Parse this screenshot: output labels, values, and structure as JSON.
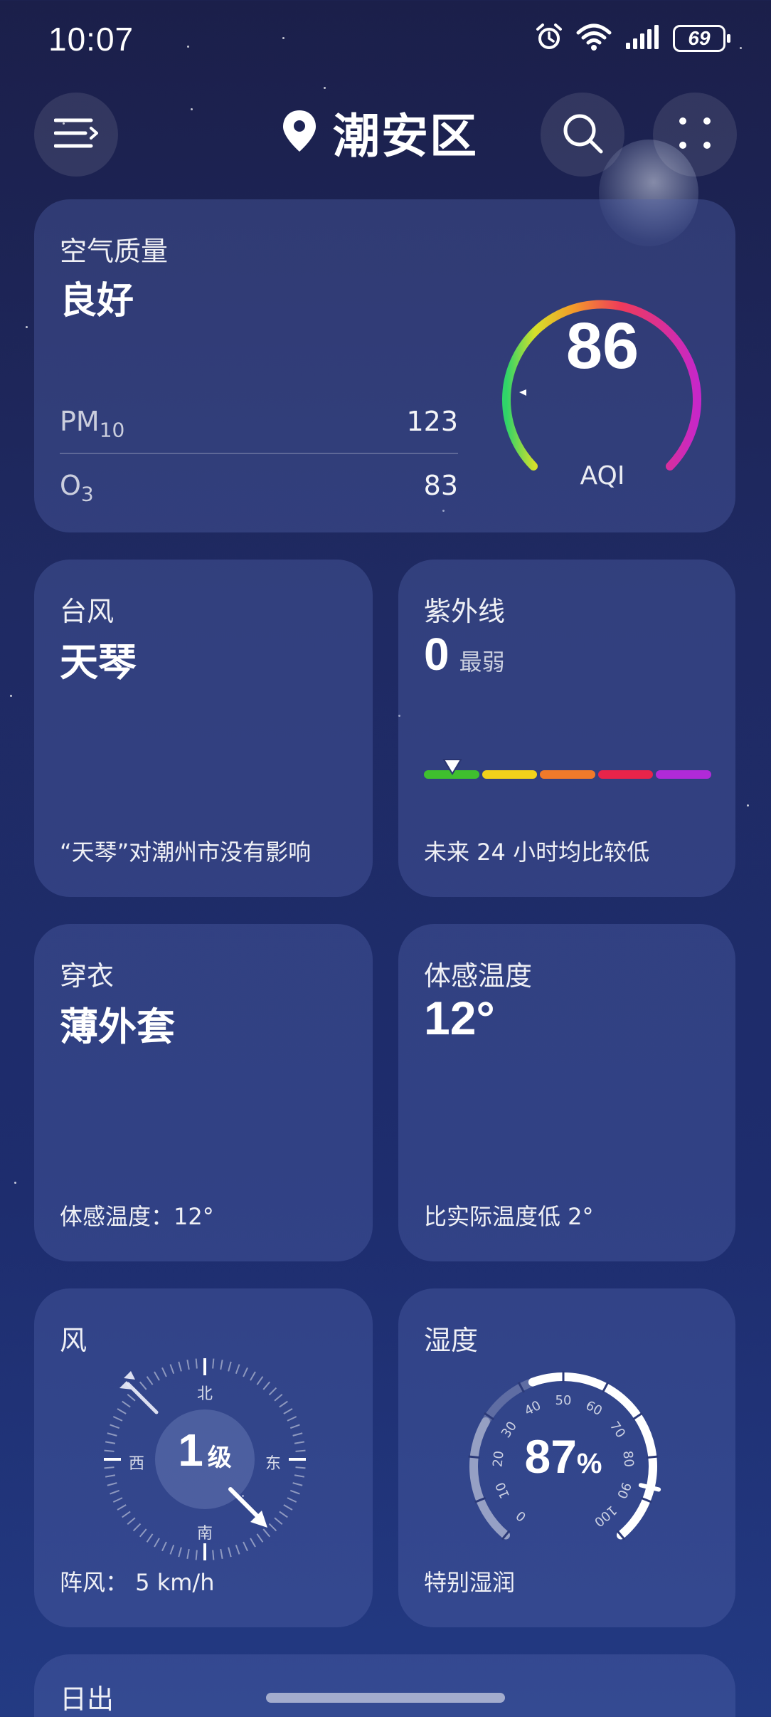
{
  "status_bar": {
    "time": "10:07",
    "battery": "69"
  },
  "header": {
    "location": "潮安区"
  },
  "air_quality": {
    "title": "空气质量",
    "level": "良好",
    "aqi_value": "86",
    "aqi_label": "AQI",
    "pm10_label": "PM",
    "pm10_sub": "10",
    "pm10_value": "123",
    "o3_label": "O",
    "o3_sub": "3",
    "o3_value": "83"
  },
  "typhoon": {
    "title": "台风",
    "name": "天琴",
    "note": "“天琴”对潮州市没有影响"
  },
  "uv": {
    "title": "紫外线",
    "index": "0",
    "level": "最弱",
    "note": "未来 24 小时均比较低",
    "scale_colors": [
      "#3fbf2e",
      "#f2d21a",
      "#f07a2a",
      "#e8244a",
      "#b12ad8"
    ],
    "level_fraction": 0.1
  },
  "clothing": {
    "title": "穿衣",
    "suggestion": "薄外套",
    "note": "体感温度：12°"
  },
  "feels_like": {
    "title": "体感温度",
    "value": "12°",
    "note": "比实际温度低 2°"
  },
  "wind": {
    "title": "风",
    "level_number": "1",
    "level_unit": "级",
    "north": "北",
    "south": "南",
    "east": "东",
    "west": "西",
    "gust": "阵风：  5 km/h"
  },
  "humidity": {
    "title": "湿度",
    "value": "87",
    "unit": "%",
    "note": "特别湿润",
    "ticks": [
      "0",
      "10",
      "20",
      "30",
      "40",
      "50",
      "60",
      "70",
      "80",
      "90",
      "100"
    ],
    "percent": 87
  },
  "sunrise": {
    "title": "日出"
  },
  "colors": {
    "background_top": "#1b1f4a",
    "background_bottom": "#233a83",
    "card": "rgba(82,100,170,0.38)"
  }
}
